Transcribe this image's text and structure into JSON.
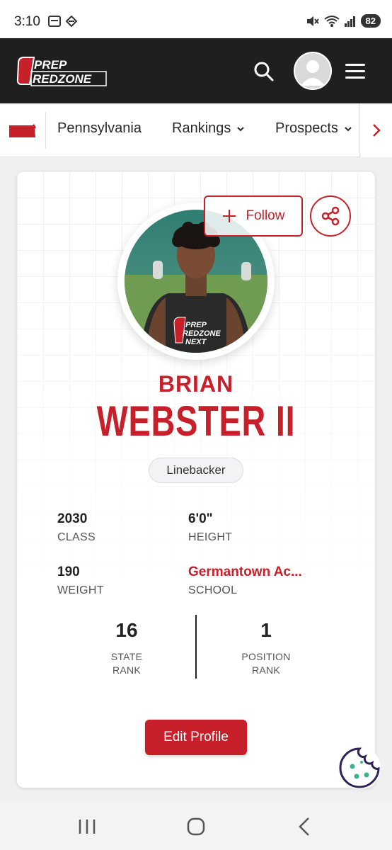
{
  "status_bar": {
    "time": "3:10",
    "battery": "82",
    "icons": [
      "calendar-icon",
      "app-icon",
      "mute-icon",
      "wifi-icon",
      "signal-icon"
    ]
  },
  "header": {
    "logo_text_top": "PREP",
    "logo_text_bottom": "REDZONE",
    "icons": [
      "search-icon",
      "avatar-icon",
      "menu-icon"
    ]
  },
  "nav": {
    "flag_icon": "pennsylvania-flag-icon",
    "items": [
      {
        "label": "Pennsylvania"
      },
      {
        "label": "Rankings"
      },
      {
        "label": "Prospects"
      }
    ]
  },
  "profile": {
    "follow_label": "Follow",
    "first_name": "BRIAN",
    "last_name": "WEBSTER II",
    "position": "Linebacker",
    "shirt_text_top": "PREP",
    "shirt_text_mid": "REDZONE",
    "shirt_text_bottom": "NEXT",
    "stats": [
      {
        "value": "2030",
        "label": "CLASS"
      },
      {
        "value": "6'0\"",
        "label": "HEIGHT"
      },
      {
        "value": "190",
        "label": "WEIGHT"
      },
      {
        "value": "Germantown Ac...",
        "label": "SCHOOL"
      }
    ],
    "ranks": [
      {
        "value": "16",
        "label_line1": "STATE",
        "label_line2": "RANK"
      },
      {
        "value": "1",
        "label_line1": "POSITION",
        "label_line2": "RANK"
      }
    ],
    "edit_label": "Edit Profile"
  },
  "colors": {
    "brand_red": "#c8202a",
    "header_bg": "#1f1f1f"
  }
}
